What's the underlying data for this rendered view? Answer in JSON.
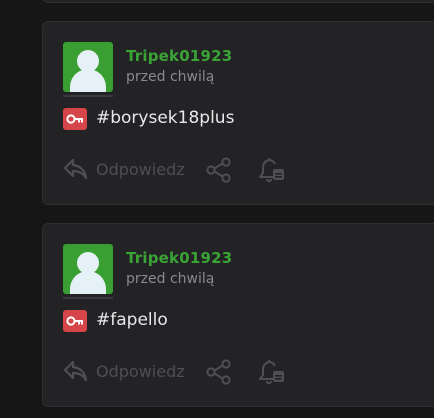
{
  "colors": {
    "background": "#161617",
    "card": "#232325",
    "username": "#3aa336",
    "avatar": "#3a9f32",
    "tag_badge": "#d64549",
    "muted": "#4f4f53"
  },
  "icons": {
    "avatar": "user-avatar-icon",
    "tag": "key-icon",
    "reply": "reply-arrow-icon",
    "share": "share-icon",
    "notify": "bell-icon"
  },
  "posts": [
    {
      "username": "Tripek01923",
      "time": "przed chwilą",
      "tag": "#borysek18plus",
      "reply_label": "Odpowiedz"
    },
    {
      "username": "Tripek01923",
      "time": "przed chwilą",
      "tag": "#fapello",
      "reply_label": "Odpowiedz"
    }
  ]
}
